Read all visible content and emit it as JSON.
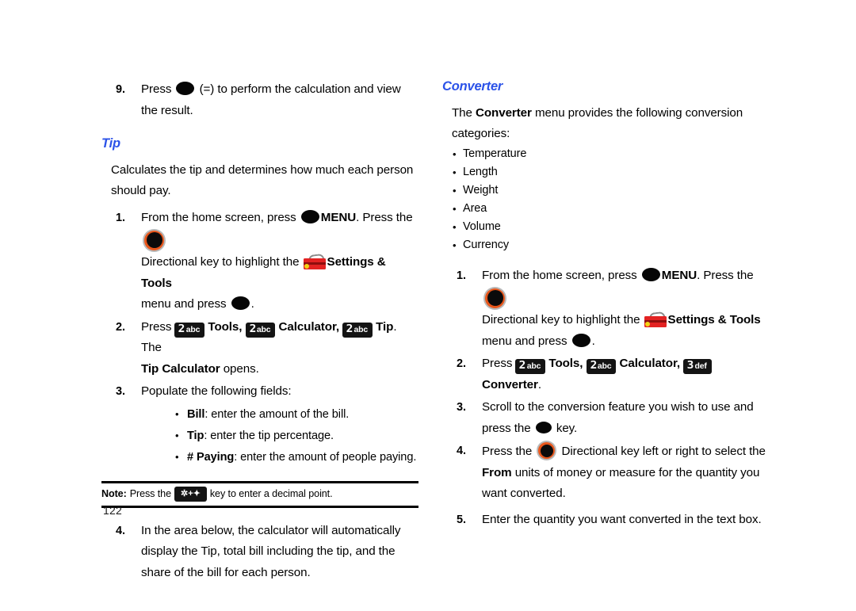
{
  "page": {
    "number": "122"
  },
  "icons": {
    "ok_key": "ok-key-icon",
    "directional_key": "directional-key-icon",
    "settings_tools": "toolbox-icon",
    "key_2_digit": "2",
    "key_2_letters": "abc",
    "key_3_digit": "3",
    "key_3_letters": "def",
    "key_star": "✲+✦"
  },
  "left_column": {
    "step9": {
      "num": "9.",
      "text_a": "Press ",
      "text_b": " (=) to perform the calculation and view the result."
    },
    "tip_section": {
      "heading": "Tip",
      "intro": "Calculates the tip and determines how much each person should pay.",
      "steps": [
        {
          "num": "1.",
          "part_a": "From the home screen, press ",
          "menu_label": "MENU",
          "part_b": ". Press the ",
          "part_c": "Directional key to highlight the ",
          "settings_label": "Settings & Tools",
          "part_d": " menu and press ",
          "part_e": "."
        },
        {
          "num": "2.",
          "part_a": "Press ",
          "tools_label": "Tools,",
          "calculator_label": "Calculator,",
          "tip_label": "Tip",
          "part_b": ". The ",
          "tip_calc_label": "Tip Calculator",
          "part_c": " opens."
        },
        {
          "num": "3.",
          "text": "Populate the following fields:",
          "fields": [
            {
              "name": "Bill",
              "desc": ": enter the amount of the bill."
            },
            {
              "name": "Tip",
              "desc": ": enter the tip percentage."
            },
            {
              "name": "# Paying",
              "desc": ": enter the amount of people paying."
            }
          ]
        },
        {
          "num": "4.",
          "text": "In the area below, the calculator will automatically display the Tip, total bill including the tip, and the share of the bill for each person."
        }
      ],
      "note": {
        "label": "Note:",
        "text_a": "Press the ",
        "text_b": " key to enter a decimal point."
      }
    }
  },
  "right_column": {
    "heading": "Converter",
    "intro_a": "The ",
    "intro_bold": "Converter",
    "intro_b": " menu provides the following conversion categories:",
    "categories": [
      "Temperature",
      "Length",
      "Weight",
      "Area",
      "Volume",
      "Currency"
    ],
    "steps": [
      {
        "num": "1.",
        "part_a": "From the home screen, press ",
        "menu_label": "MENU",
        "part_b": ". Press the ",
        "part_c": "Directional key to highlight the ",
        "settings_label": "Settings & Tools",
        "part_d": " menu and press ",
        "part_e": "."
      },
      {
        "num": "2.",
        "part_a": "Press ",
        "tools_label": "Tools,",
        "calculator_label": "Calculator,",
        "converter_label": "Converter",
        "part_b": "."
      },
      {
        "num": "3.",
        "part_a": "Scroll to the conversion feature you wish to use and press the ",
        "part_b": " key."
      },
      {
        "num": "4.",
        "part_a": "Press the ",
        "part_b": " Directional key left or right to select the ",
        "from_label": "From",
        "part_c": " units of money or measure for the quantity you want converted."
      },
      {
        "num": "5.",
        "text": "Enter the quantity you want converted in the text box."
      }
    ]
  },
  "colors": {
    "heading_blue": "#2b52e8",
    "key_black": "#141414",
    "toolbox_red": "#e32222",
    "dir_ring_orange": "#e8561b"
  }
}
